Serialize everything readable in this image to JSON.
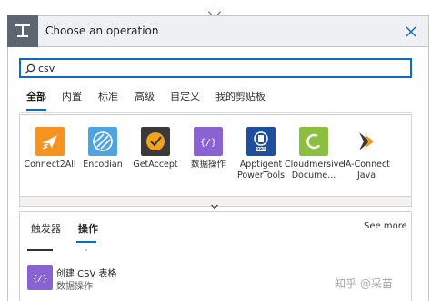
{
  "header": {
    "title": "Choose an operation"
  },
  "search": {
    "value": "csv",
    "placeholder": ""
  },
  "tabs": [
    {
      "label": "全部",
      "active": true
    },
    {
      "label": "内置",
      "active": false
    },
    {
      "label": "标准",
      "active": false
    },
    {
      "label": "高级",
      "active": false
    },
    {
      "label": "自定义",
      "active": false
    },
    {
      "label": "我的剪贴板",
      "active": false
    }
  ],
  "connectors": [
    {
      "label": "Connect2All",
      "icon": "connect2all-icon",
      "color": "#f7931e"
    },
    {
      "label": "Encodian",
      "icon": "encodian-icon",
      "color": "#4fa3e0"
    },
    {
      "label": "GetAccept",
      "icon": "getaccept-icon",
      "color": "#3b3a39"
    },
    {
      "label": "数据操作",
      "icon": "data-operation-icon",
      "color": "#8a63d2"
    },
    {
      "label": "Apptigent PowerTools",
      "icon": "apptigent-icon",
      "color": "#1e4f9c"
    },
    {
      "label": "Cloudmersive Docume...",
      "icon": "cloudmersive-icon",
      "color": "#8cbf3f"
    },
    {
      "label": "IA-Connect Java",
      "icon": "ia-connect-icon",
      "color": "#ffffff"
    }
  ],
  "lower_tabs": [
    {
      "label": "触发器",
      "active": false
    },
    {
      "label": "操作",
      "active": true
    }
  ],
  "see_more": "See more",
  "actions": [
    {
      "title": "创建 CSV 表格",
      "subtitle": "数据操作",
      "icon": "data-operation-icon"
    }
  ],
  "watermark": "知乎 @采苗"
}
